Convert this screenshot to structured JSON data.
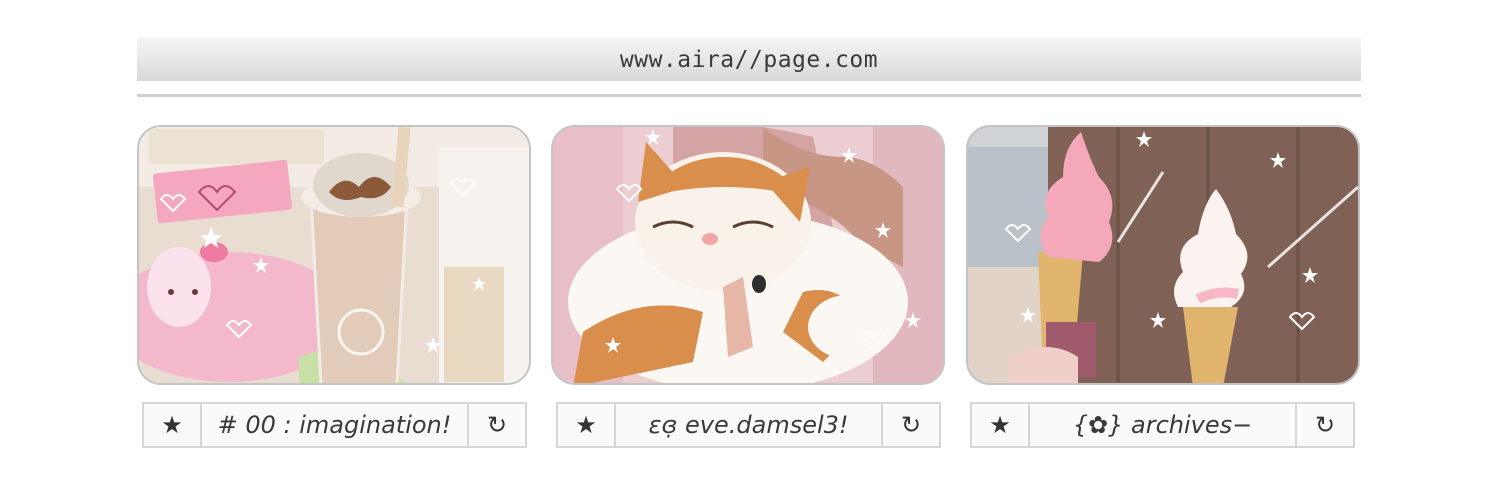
{
  "address_bar": {
    "url": "www.aira//page.com"
  },
  "cards": [
    {
      "image_alt": "iced coffee with cream beside a pink plush toy",
      "label": "# 00 : imagination!",
      "star_icon": "★",
      "refresh_icon": "↻"
    },
    {
      "image_alt": "orange and white cat sleeping in someone's lap",
      "label": "εɞ̣  eve.damsel3!",
      "star_icon": "★",
      "refresh_icon": "↻"
    },
    {
      "image_alt": "two pink soft-serve ice cream cones",
      "label": "{✿} archives−",
      "star_icon": "★",
      "refresh_icon": "↻"
    }
  ]
}
